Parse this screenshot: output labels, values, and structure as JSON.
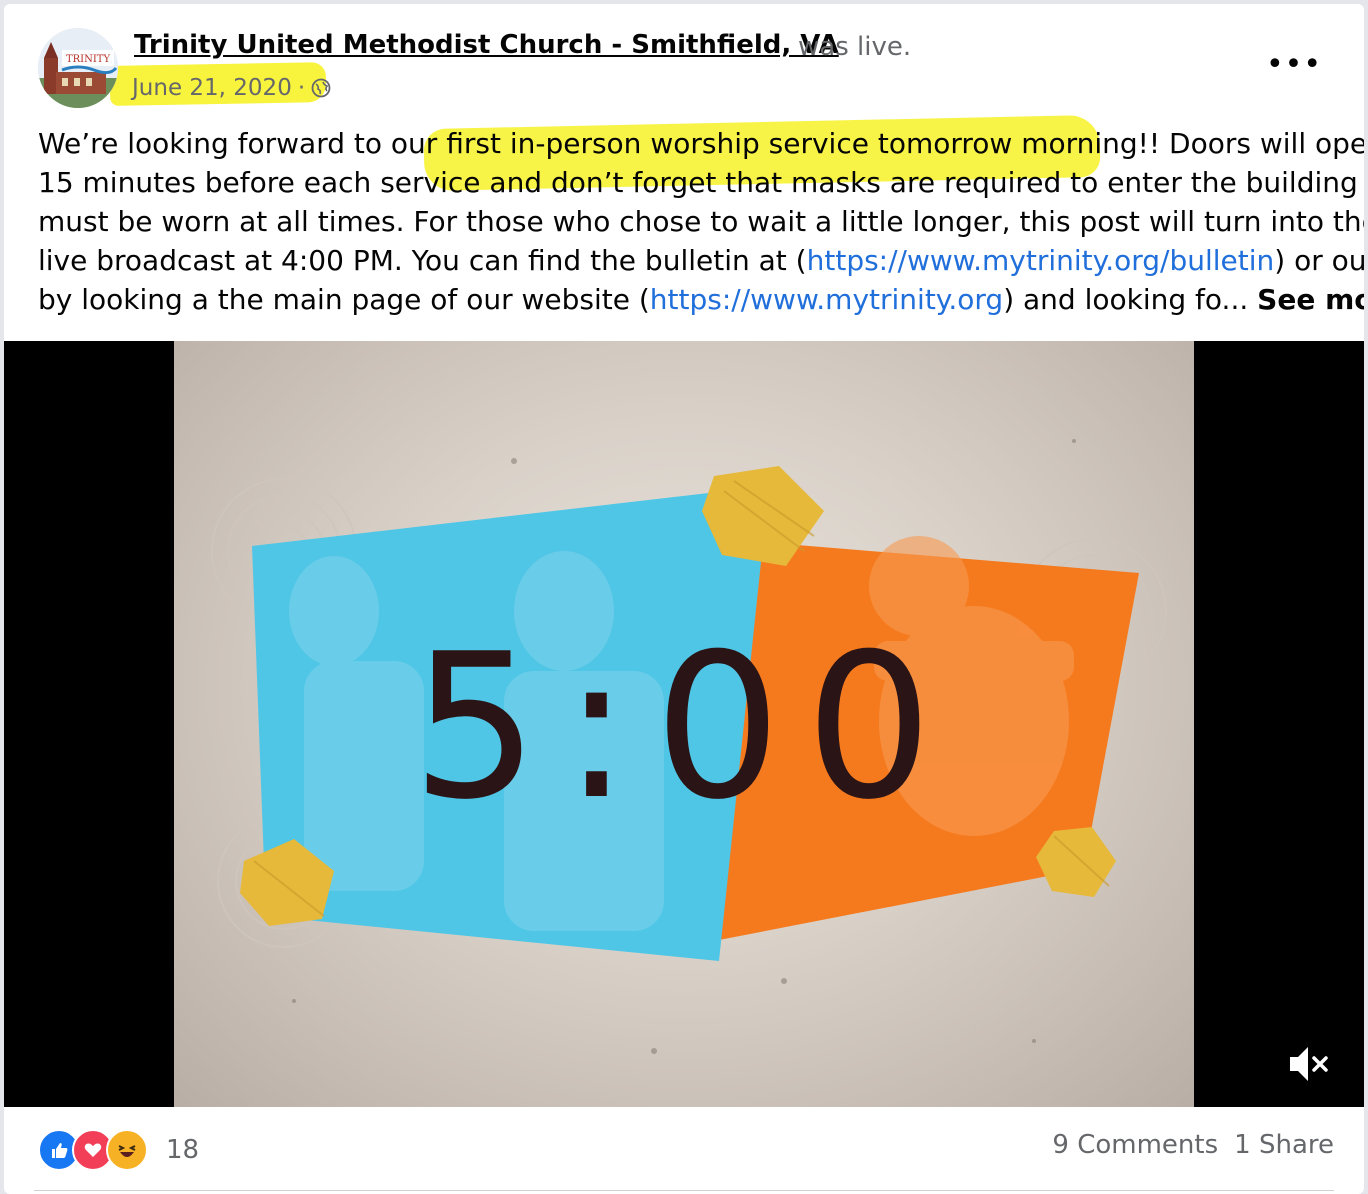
{
  "post": {
    "page_name": "Trinity United Methodist Church - Smithfield, VA",
    "status": "was live.",
    "date": "June 21, 2020",
    "date_separator": "·",
    "privacy_icon": "globe-icon",
    "avatar_label": "TRINITY",
    "more_label": "•••",
    "text": {
      "l1a": "We’re looking forward to our first in-person worship service tomorrow morning!! Doors will open",
      "l2": "15 minutes before each service and don’t forget that masks are required to enter the building and",
      "l3": "must be worn at all times.  For those who chose to wait a little longer, this post will turn into the",
      "l4_pre": "live broadcast at 4:00 PM. You can find the bulletin at (",
      "l4_link": "https://www.mytrinity.org/bulletin",
      "l4_post": ") or our",
      "l5_pre": "by looking a the main page of our website (",
      "l5_link": "https://www.mytrinity.org",
      "l5_post": ") and looking fo...",
      "see_more": "See more"
    }
  },
  "video": {
    "countdown": "5:00",
    "mute_icon": "speaker-muted-icon"
  },
  "footer": {
    "reaction_icons": [
      "like-icon",
      "love-icon",
      "haha-icon"
    ],
    "reaction_count": "18",
    "comments": "9 Comments",
    "shares": "1 Share"
  },
  "colors": {
    "highlight": "#f7f227",
    "link": "#216fdb",
    "blue_panel": "#4fc6e6",
    "orange_panel": "#f57a1e",
    "gold": "#e6b93a"
  }
}
